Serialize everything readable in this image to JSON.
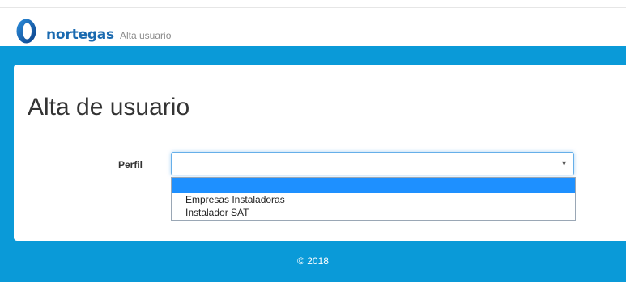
{
  "header": {
    "brand": "nortegas",
    "breadcrumb": "Alta usuario"
  },
  "main": {
    "title": "Alta de usuario",
    "form": {
      "profile_label": "Perfil",
      "profile_value": "",
      "profile_options": [
        "",
        "Empresas Instaladoras",
        "Instalador SAT"
      ],
      "selected_index": 0
    }
  },
  "footer": {
    "copyright": "© 2018"
  },
  "colors": {
    "brand_blue": "#1a6ab0",
    "band_blue": "#0a9ad8",
    "selection_blue": "#1e90ff"
  },
  "icons": {
    "logo": "nortegas-logo-icon",
    "caret": "caret-down-icon"
  }
}
